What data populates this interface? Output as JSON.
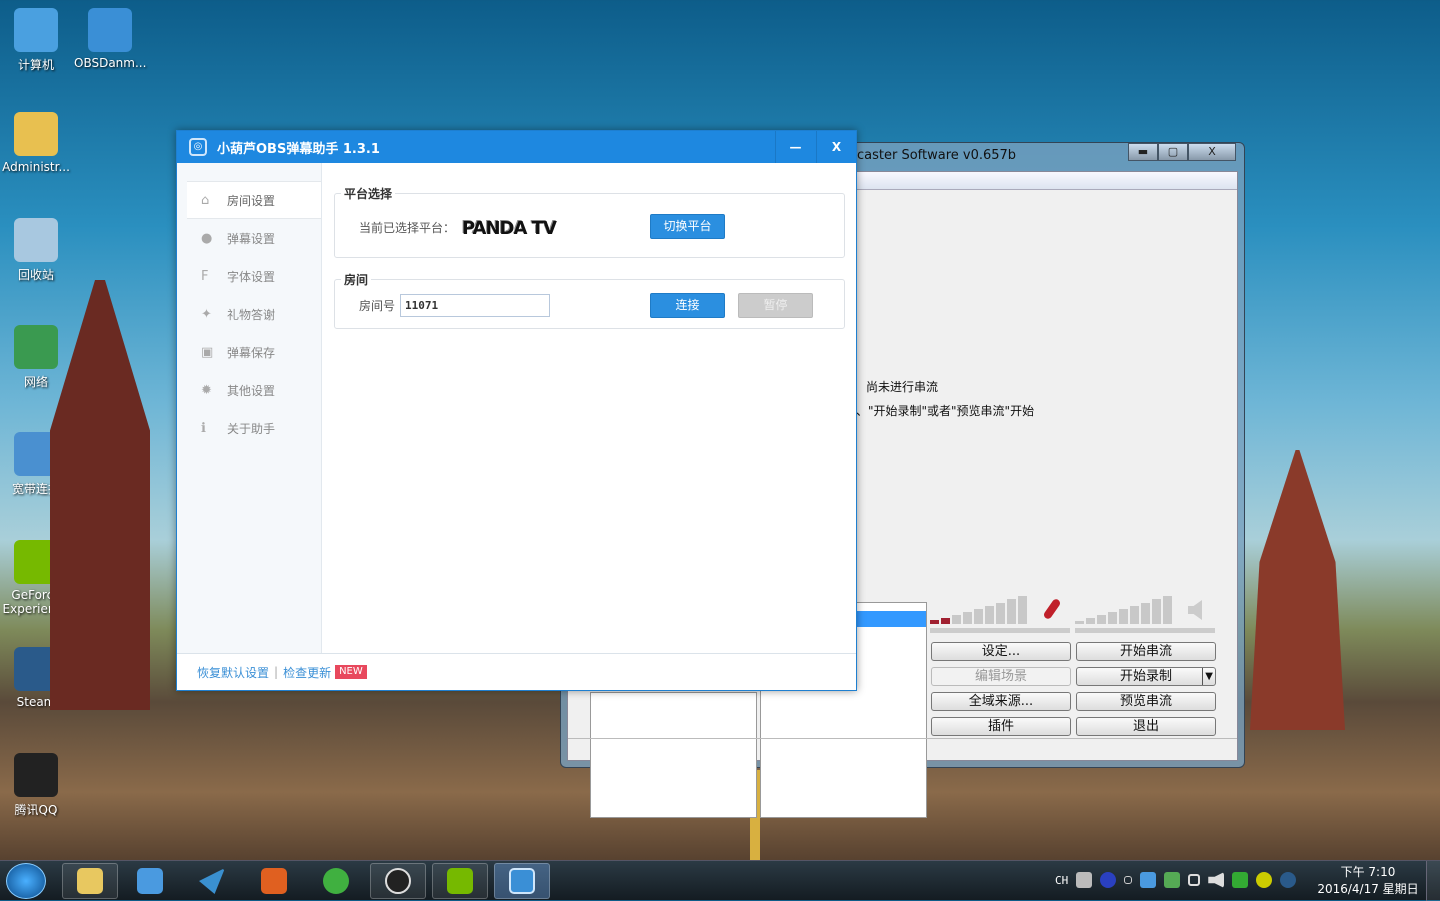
{
  "desktop": {
    "icons": [
      {
        "label": "计算机",
        "icon": "computer-icon",
        "color": "#4aa0e0"
      },
      {
        "label": "OBSDanm...",
        "icon": "obsdanmu-icon",
        "color": "#3a8fd6"
      },
      {
        "label": "Administr...",
        "icon": "user-folder-icon",
        "color": "#e8c050"
      },
      {
        "label": "回收站",
        "icon": "recycle-bin-icon",
        "color": "#a8c8e0"
      },
      {
        "label": "网络",
        "icon": "network-icon",
        "color": "#3a9a50"
      },
      {
        "label": "宽带连接",
        "icon": "broadband-icon",
        "color": "#4a90d0"
      },
      {
        "label": "GeForce Experience",
        "icon": "geforce-icon",
        "color": "#76b900"
      },
      {
        "label": "Steam",
        "icon": "steam-icon",
        "color": "#2a5a8a"
      },
      {
        "label": "腾讯QQ",
        "icon": "qq-icon",
        "color": "#222"
      }
    ]
  },
  "obs": {
    "title": "caster Software v0.657b",
    "minimize": "▬",
    "maximize": "▢",
    "close": "X",
    "status_line1": "尚未进行串流",
    "status_line2": "、\"开始录制\"或者\"预览串流\"开始",
    "buttons": {
      "settings": "设定...",
      "start_stream": "开始串流",
      "edit_scene": "编辑场景",
      "start_record": "开始录制",
      "global_sources": "全域来源...",
      "preview_stream": "预览串流",
      "plugins": "插件",
      "exit": "退出"
    }
  },
  "app": {
    "title": "小葫芦OBS弹幕助手 1.3.1",
    "minimize": "—",
    "close": "X",
    "sidebar": [
      {
        "label": "房间设置",
        "icon": "home-icon",
        "glyph": "⌂"
      },
      {
        "label": "弹幕设置",
        "icon": "chat-bubble-icon",
        "glyph": "●"
      },
      {
        "label": "字体设置",
        "icon": "font-icon",
        "glyph": "F"
      },
      {
        "label": "礼物答谢",
        "icon": "gift-icon",
        "glyph": "✦"
      },
      {
        "label": "弹幕保存",
        "icon": "save-icon",
        "glyph": "▣"
      },
      {
        "label": "其他设置",
        "icon": "gear-icon",
        "glyph": "✹"
      },
      {
        "label": "关于助手",
        "icon": "info-icon",
        "glyph": "ℹ"
      }
    ],
    "platform": {
      "legend": "平台选择",
      "label": "当前已选择平台：",
      "logo": "PANDA TV",
      "switch_button": "切换平台"
    },
    "room": {
      "legend": "房间",
      "label": "房间号",
      "value": "11071",
      "connect_button": "连接",
      "pause_button": "暂停"
    },
    "footer": {
      "reset": "恢复默认设置",
      "separator": "|",
      "check_update": "检查更新",
      "badge": "NEW"
    }
  },
  "taskbar": {
    "lang": "CH",
    "time": "下午 7:10",
    "date": "2016/4/17 星期日"
  }
}
